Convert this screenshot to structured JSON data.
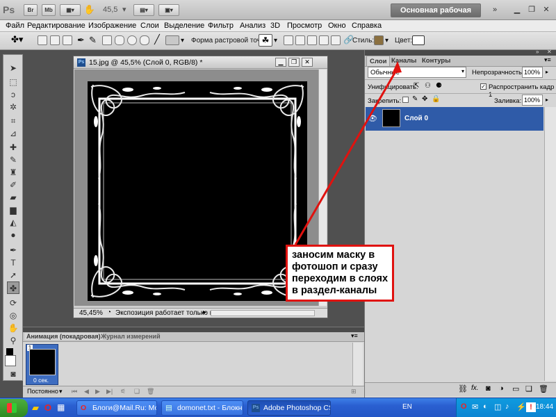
{
  "app": {
    "logo_text": "Ps",
    "bar_buttons": [
      "Br",
      "Mb"
    ],
    "zoom": "45,5",
    "workspace_label": "Основная рабочая среда"
  },
  "menu": {
    "items": [
      "Файл",
      "Редактирование",
      "Изображение",
      "Слои",
      "Выделение",
      "Фильтр",
      "Анализ",
      "3D",
      "Просмотр",
      "Окно",
      "Справка"
    ]
  },
  "options": {
    "raster_shape_label": "Форма растровой точки:",
    "style_label": "Стиль:",
    "color_label": "Цвет:"
  },
  "document": {
    "title": "15.jpg @ 45,5% (Слой 0, RGB/8) *",
    "status_zoom": "45,45%",
    "status_text": "Экспозиция работает только в ..."
  },
  "callout": {
    "text": "заносим маску в фотошоп и сразу переходим в слоях в раздел-каналы"
  },
  "layers_panel": {
    "tabs": [
      "Слои",
      "Каналы",
      "Контуры"
    ],
    "blend_mode": "Обычные",
    "opacity_label": "Непрозрачность:",
    "opacity_value": "100%",
    "unify_label": "Унифицировать:",
    "propagate_label": "Распространить кадр 1",
    "lock_label": "Закрепить:",
    "fill_label": "Заливка:",
    "fill_value": "100%",
    "layer_name": "Слой 0"
  },
  "animation_panel": {
    "tabs": [
      "Анимация (покадровая)",
      "Журнал измерений"
    ],
    "frame_number": "1",
    "frame_delay": "0 сек.",
    "loop_value": "Постоянно"
  },
  "taskbar": {
    "tasks": [
      "Блоги@Mail.Ru: Мой ...",
      "domonet.txt - Блокнот",
      "Adobe Photoshop CS..."
    ],
    "lang": "EN",
    "clock": "18:44"
  },
  "colors": {
    "accent_red": "#e0120f",
    "selected_layer": "#2f5ba8",
    "taskbar_blue": "#2a5fd0"
  }
}
